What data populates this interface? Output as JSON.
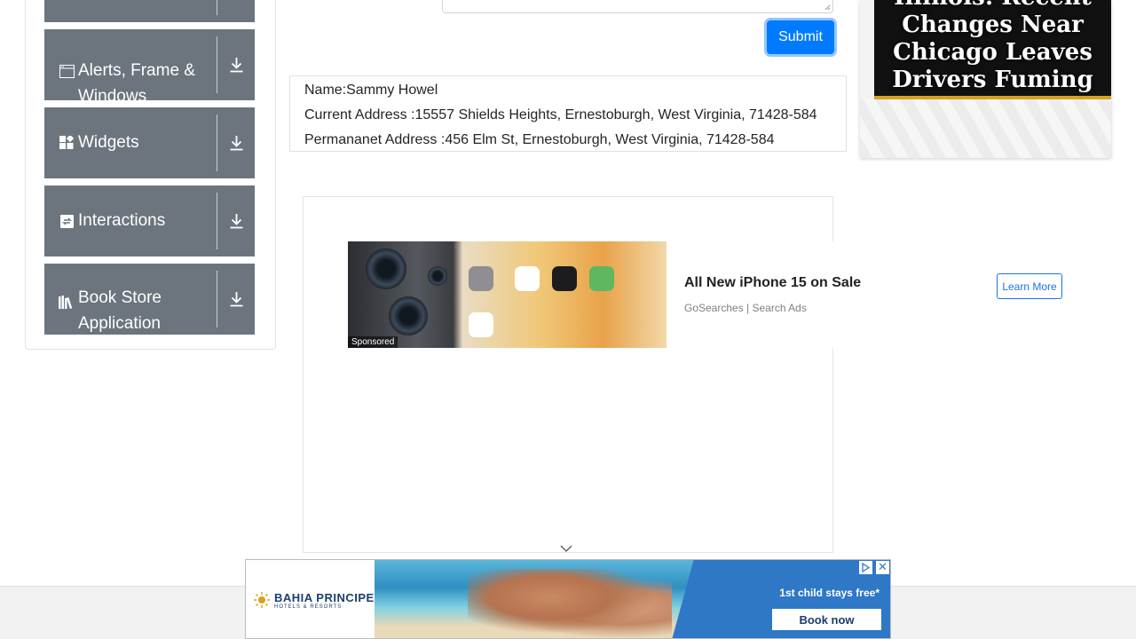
{
  "sidebar": {
    "groups": [
      {
        "label": "",
        "icon": "collapsed-group-icon"
      },
      {
        "label": "Alerts, Frame & Windows",
        "icon": "window-icon"
      },
      {
        "label": "Widgets",
        "icon": "widgets-icon"
      },
      {
        "label": "Interactions",
        "icon": "interactions-icon"
      },
      {
        "label": "Book Store Application",
        "icon": "books-icon"
      }
    ]
  },
  "form": {
    "submit_label": "Submit"
  },
  "output": {
    "name": "Name:Sammy Howel",
    "current_address": "Current Address :15557 Shields Heights, Ernestoburgh, West Virginia, 71428-584",
    "permanent_address": "Permananet Address :456 Elm St, Ernestoburgh, West Virginia, 71428-584"
  },
  "sponsored_ad": {
    "tag": "Sponsored",
    "title": "All New iPhone 15 on Sale",
    "source": "GoSearches | Search Ads",
    "cta": "Learn More"
  },
  "right_ad": {
    "headline_lines": [
      "Illinois: Recent",
      "Changes Near",
      "Chicago Leaves",
      "Drivers Fuming"
    ]
  },
  "bottom_ad": {
    "brand": "BAHIA PRINCIPE",
    "brand_sub": "HOTELS & RESORTS",
    "offer": "1st child stays free*",
    "cta": "Book now"
  },
  "colors": {
    "accordion_bg": "#6c757d",
    "submit_bg": "#007bff",
    "ad_accent": "#1a73e8"
  }
}
